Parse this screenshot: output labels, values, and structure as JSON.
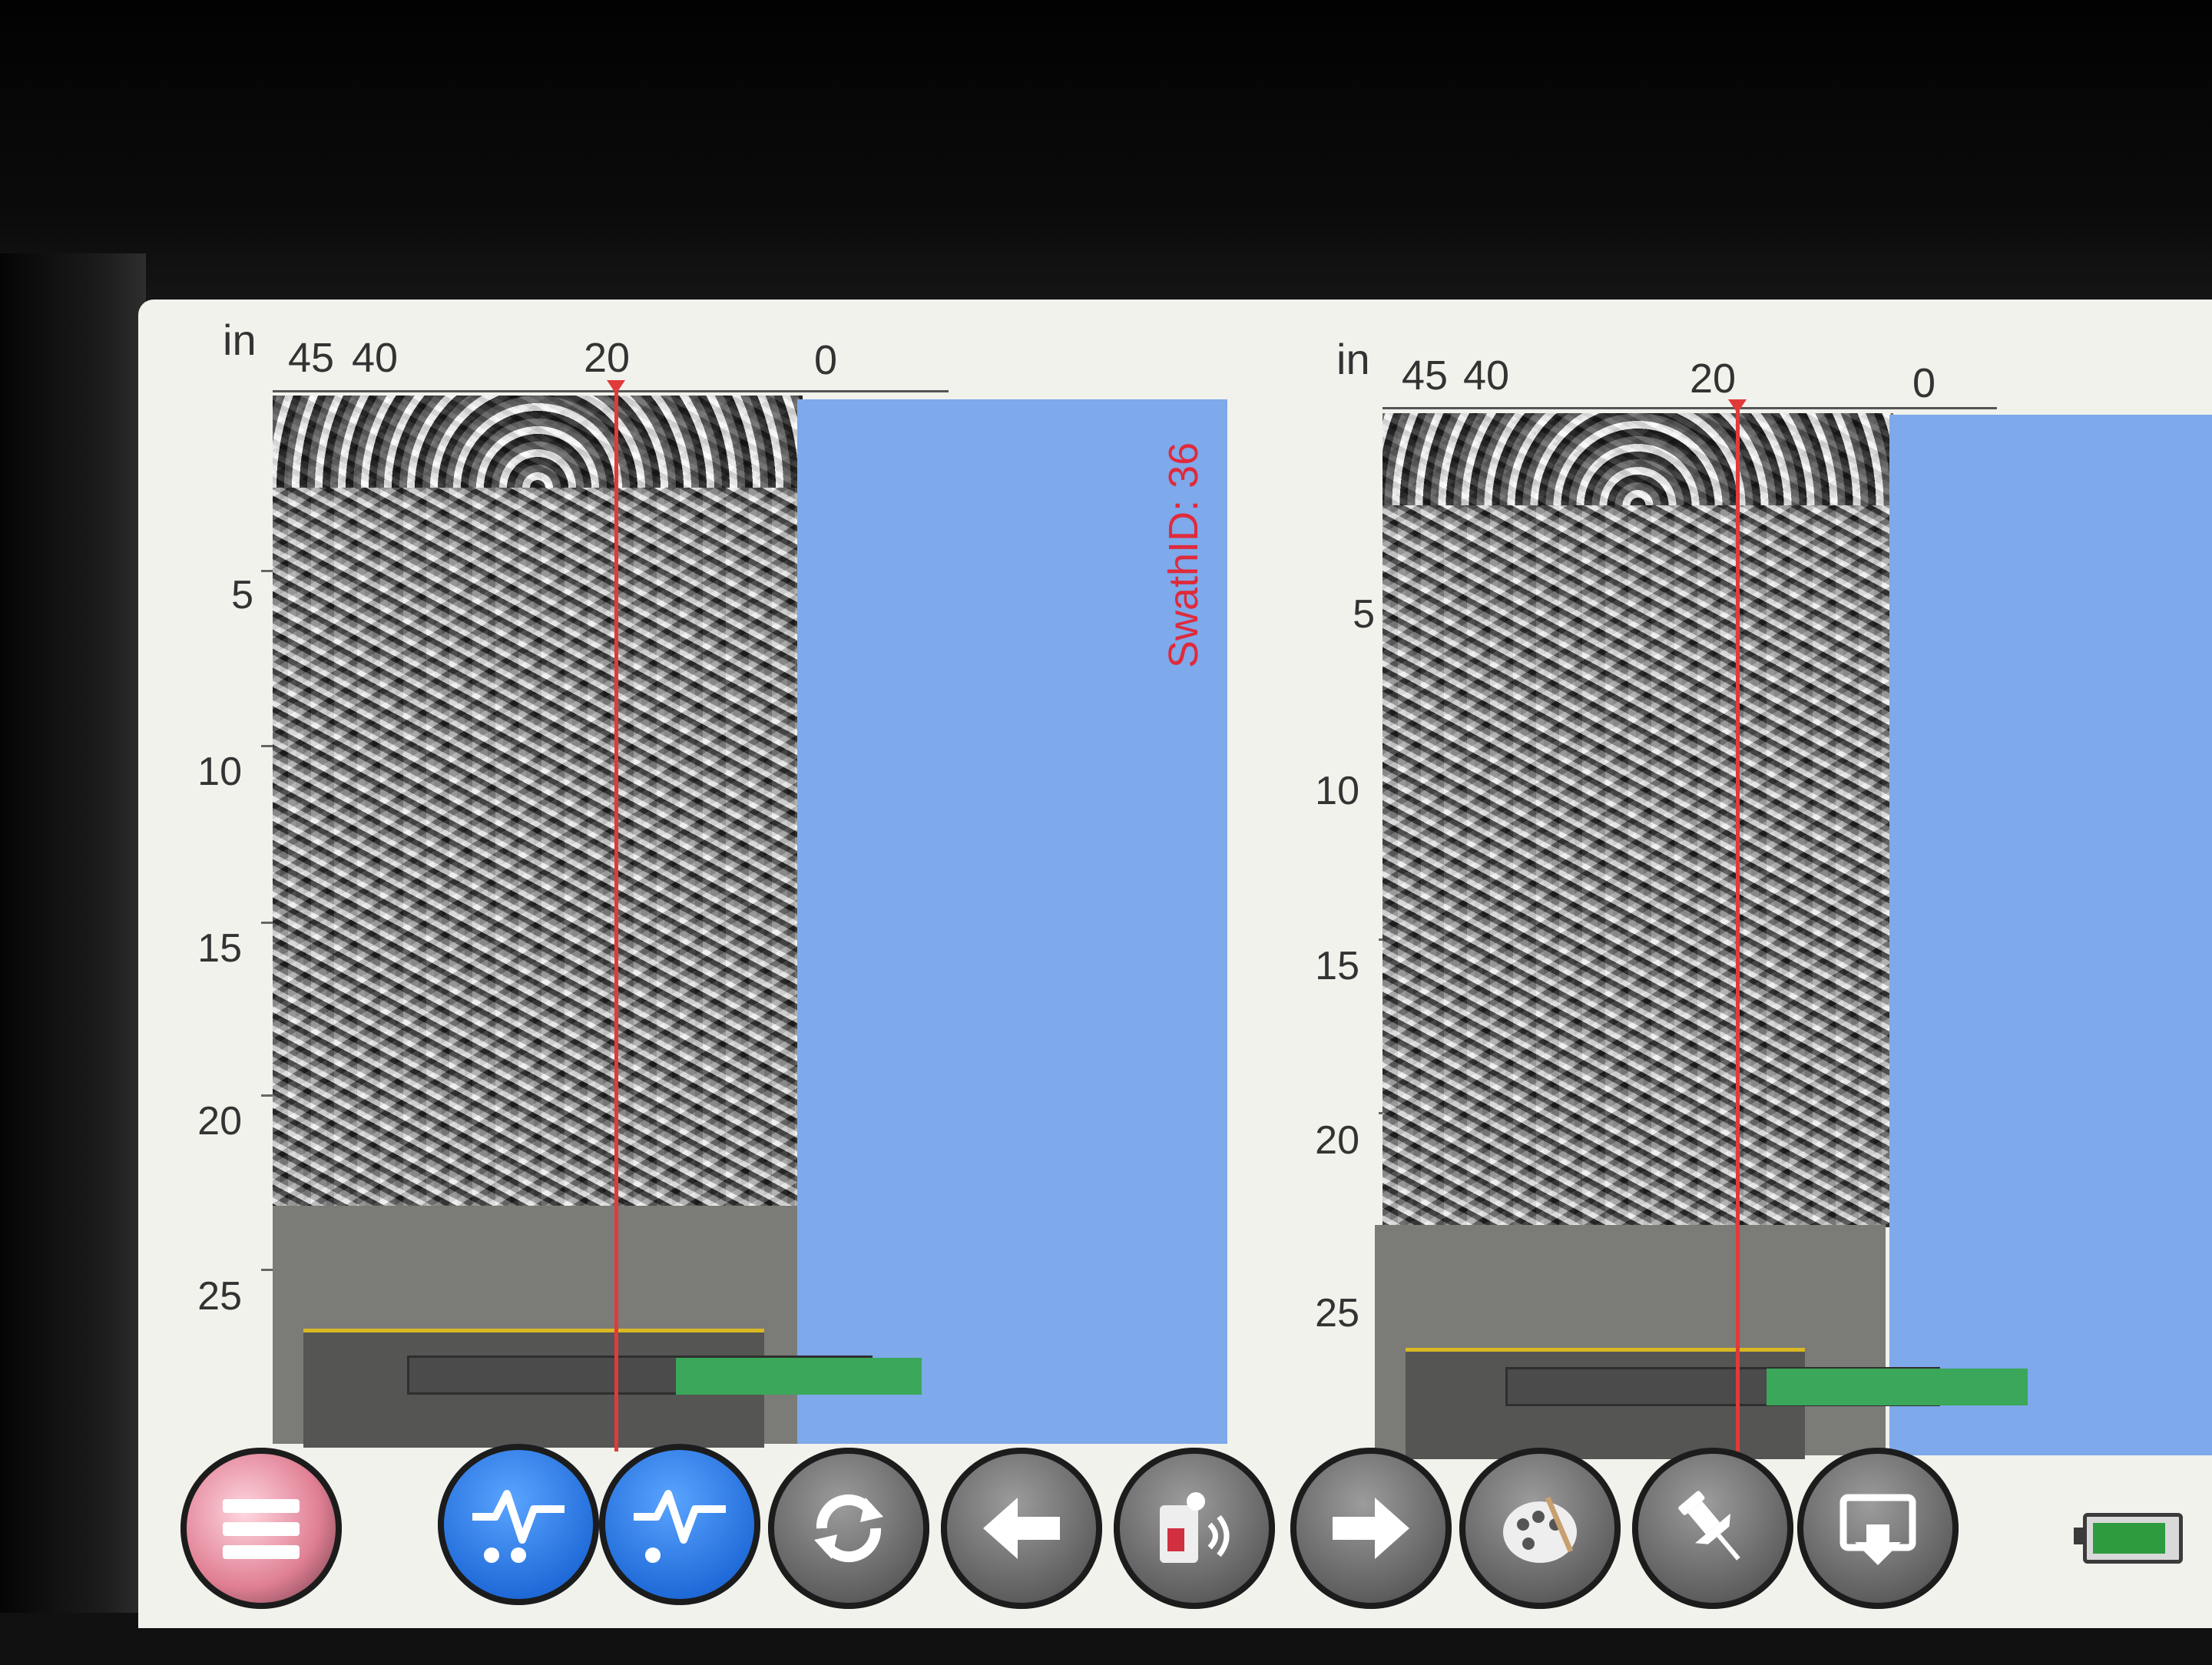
{
  "panels": [
    {
      "unit": "in",
      "x_ticks": [
        "45",
        "40",
        "20",
        "0"
      ],
      "y_ticks": [
        "5",
        "10",
        "15",
        "20",
        "25"
      ],
      "swath_label": "SwathID: 36"
    },
    {
      "unit": "in",
      "x_ticks": [
        "45",
        "40",
        "20",
        "0"
      ],
      "y_ticks": [
        "5",
        "10",
        "15",
        "20",
        "25"
      ]
    }
  ],
  "toolbar": {
    "buttons": [
      {
        "icon": "menu-icon"
      },
      {
        "icon": "signal-trace-icon"
      },
      {
        "icon": "signal-trace-icon"
      },
      {
        "icon": "refresh-icon"
      },
      {
        "icon": "arrow-left-icon"
      },
      {
        "icon": "scan-device-icon"
      },
      {
        "icon": "arrow-right-icon"
      },
      {
        "icon": "palette-icon"
      },
      {
        "icon": "pin-icon"
      },
      {
        "icon": "export-icon"
      }
    ]
  },
  "battery": {
    "level": 0.9
  },
  "colors": {
    "cursor": "#e23a3a",
    "progress": "#3aa75a",
    "sky_area": "#7ea9ea",
    "active_button": "#1f6ad8"
  }
}
